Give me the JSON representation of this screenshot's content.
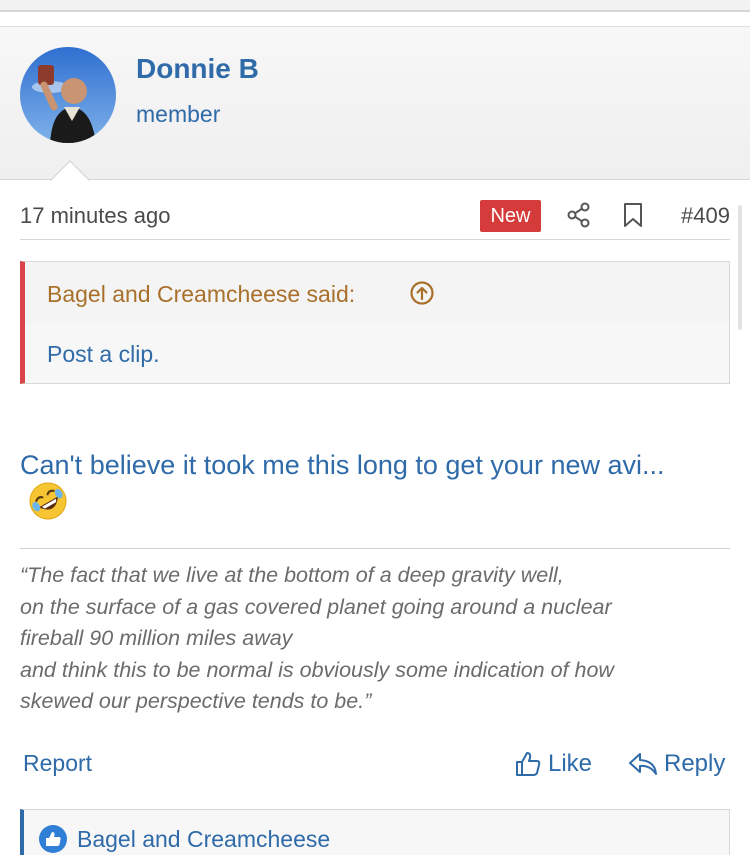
{
  "post": {
    "username": "Donnie B",
    "user_title": "member",
    "timestamp": "17 minutes ago",
    "new_badge": "New",
    "post_number": "#409"
  },
  "quote": {
    "author_label": "Bagel and Creamcheese said:",
    "text": "Post a clip."
  },
  "body": {
    "text": "Can't believe it took me this long to get your new avi...",
    "emoji": "rolling-on-floor-laughing"
  },
  "signature": {
    "lines": [
      "“The fact that we live at the bottom of a deep gravity well,",
      "on the surface of a gas covered planet going around a nuclear",
      "fireball 90 million miles away",
      "and think this to be normal is obviously some indication of how",
      "skewed our perspective tends to be.”"
    ]
  },
  "actions": {
    "report": "Report",
    "like": "Like",
    "reply": "Reply"
  },
  "reactions": {
    "users": "Bagel and Creamcheese"
  },
  "colors": {
    "link": "#2f6aa9",
    "badge_new": "#d63b3b",
    "quote_accent": "#d9434a",
    "quote_author": "#a8702b"
  }
}
